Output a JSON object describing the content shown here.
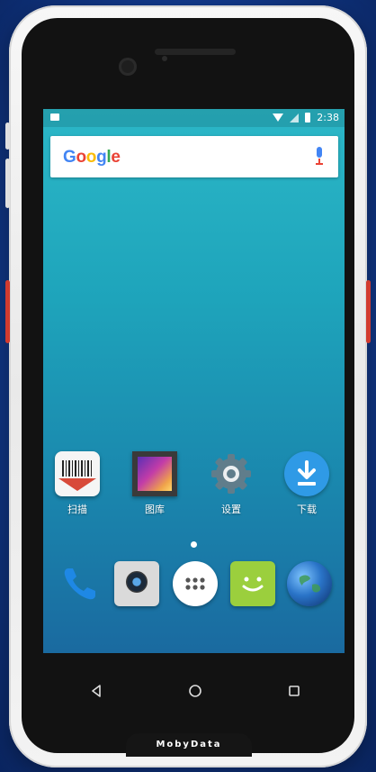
{
  "status_bar": {
    "time": "2:38"
  },
  "search": {
    "logo_letters": [
      "G",
      "o",
      "o",
      "g",
      "l",
      "e"
    ]
  },
  "apps": [
    {
      "label": "扫描"
    },
    {
      "label": "图库"
    },
    {
      "label": "设置"
    },
    {
      "label": "下载"
    }
  ],
  "dock": [
    "phone",
    "camera",
    "all-apps",
    "messages",
    "browser"
  ],
  "navigation": [
    "back",
    "home",
    "recents"
  ],
  "brand": "MobyData",
  "colors": {
    "wallpaper_top": "#2bb7c7",
    "wallpaper_bottom": "#1a6aa0",
    "phone_body": "#f3f3f3",
    "accent_red": "#d23b2f",
    "download_blue": "#2f9ae6",
    "message_green": "#9bcf3d"
  },
  "icons": {
    "wifi": "wifi-icon",
    "signal": "signal-icon",
    "battery": "battery-icon",
    "mic": "mic-icon",
    "scan": "barcode-scanner-icon",
    "gallery": "gallery-icon",
    "settings": "gear-icon",
    "download": "download-icon",
    "phone": "phone-icon",
    "camera": "camera-icon",
    "all_apps": "app-drawer-icon",
    "messages": "message-icon",
    "browser": "globe-icon"
  }
}
